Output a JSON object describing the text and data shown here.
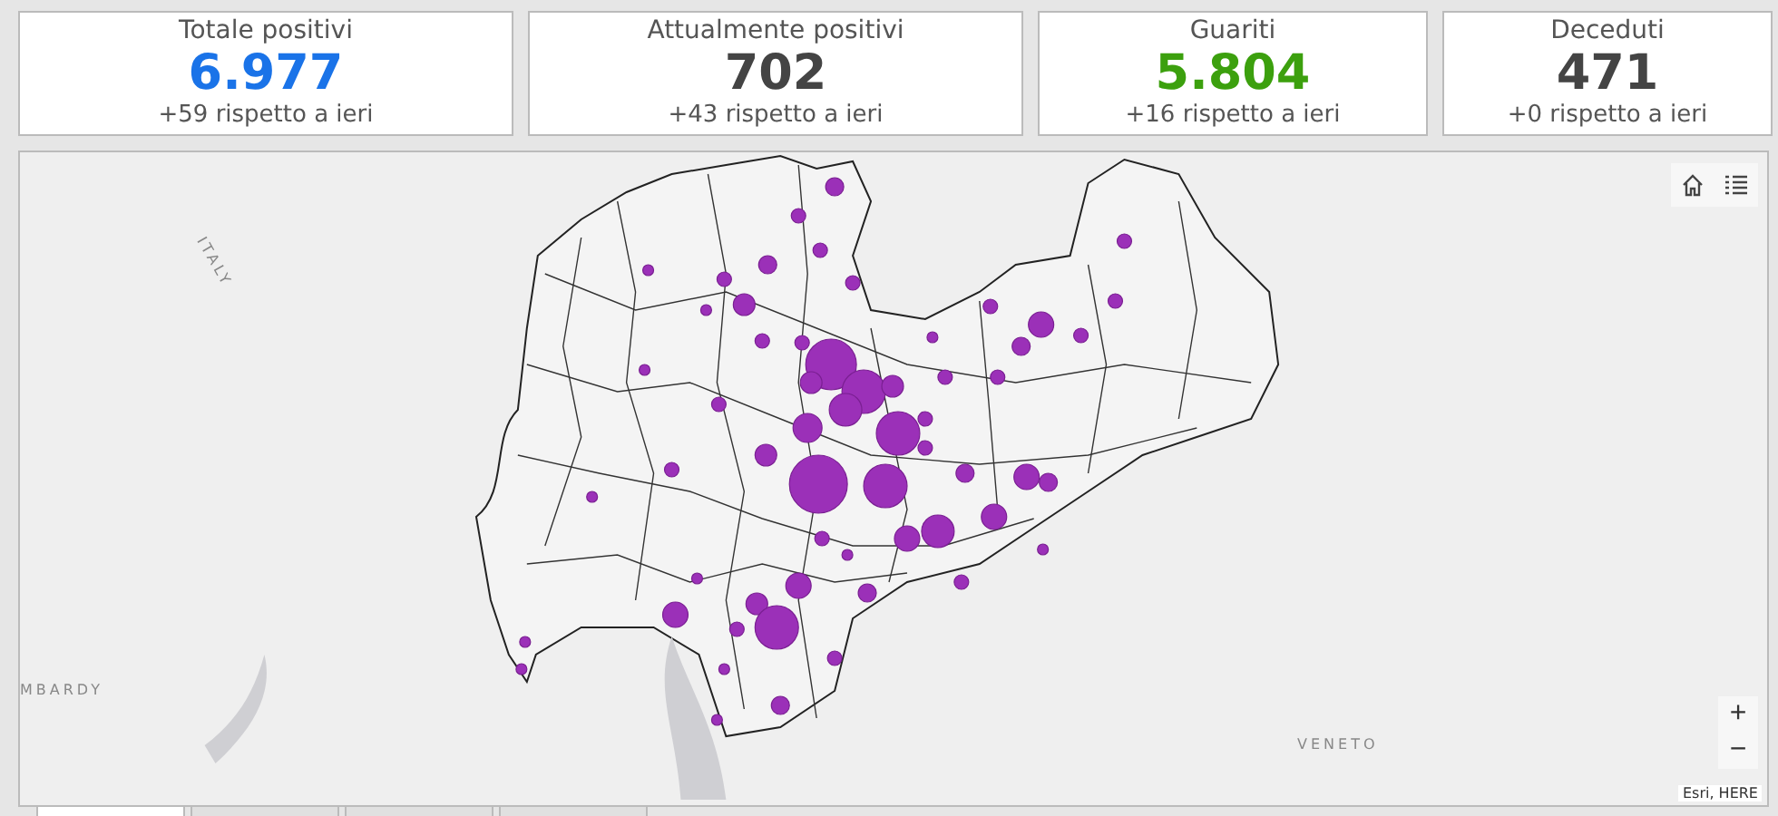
{
  "cards": [
    {
      "title": "Totale positivi",
      "value": "6.977",
      "change": "+59 rispetto a ieri",
      "color": "#1a73e8"
    },
    {
      "title": "Attualmente positivi",
      "value": "702",
      "change": "+43 rispetto a ieri",
      "color": "#444444"
    },
    {
      "title": "Guariti",
      "value": "5.804",
      "change": "+16 rispetto a ieri",
      "color": "#3ca00e"
    },
    {
      "title": "Deceduti",
      "value": "471",
      "change": "+0 rispetto a ieri",
      "color": "#444444"
    }
  ],
  "map": {
    "labels": [
      {
        "text": "ITALY",
        "kind": "country"
      },
      {
        "text": "MBARDY",
        "kind": "edge"
      },
      {
        "text": "VENETO",
        "kind": "region"
      }
    ],
    "zoom_in": "+",
    "zoom_out": "−",
    "attribution": "Esri, HERE"
  },
  "bottom_tabs": [
    {
      "selected": true
    },
    {
      "selected": false
    },
    {
      "selected": false
    },
    {
      "selected": false
    }
  ]
}
